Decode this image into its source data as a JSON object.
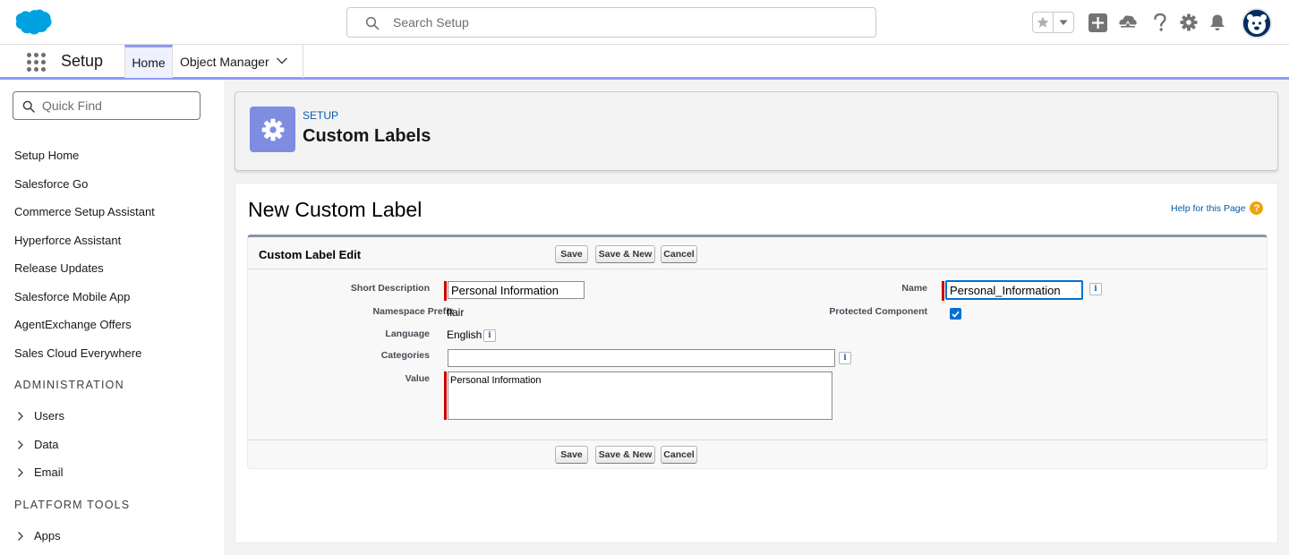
{
  "header": {
    "search_placeholder": "Search Setup"
  },
  "nav": {
    "app_name": "Setup",
    "tabs": [
      {
        "label": "Home"
      },
      {
        "label": "Object Manager"
      }
    ]
  },
  "sidebar": {
    "quick_find_placeholder": "Quick Find",
    "links": [
      "Setup Home",
      "Salesforce Go",
      "Commerce Setup Assistant",
      "Hyperforce Assistant",
      "Release Updates",
      "Salesforce Mobile App",
      "AgentExchange Offers",
      "Sales Cloud Everywhere"
    ],
    "sections": [
      {
        "title": "ADMINISTRATION",
        "items": [
          "Users",
          "Data",
          "Email"
        ]
      },
      {
        "title": "PLATFORM TOOLS",
        "items": [
          "Apps"
        ]
      }
    ]
  },
  "page_header": {
    "eyebrow": "SETUP",
    "title": "Custom Labels"
  },
  "content": {
    "title": "New Custom Label",
    "help_link": "Help for this Page",
    "help_icon_glyph": "?",
    "edit_block": {
      "title": "Custom Label Edit",
      "buttons": {
        "save": "Save",
        "save_new": "Save & New",
        "cancel": "Cancel"
      },
      "fields": {
        "short_description": {
          "label": "Short Description",
          "value": "Personal Information"
        },
        "name": {
          "label": "Name",
          "value": "Personal_Information"
        },
        "namespace_prefix": {
          "label": "Namespace Prefix",
          "value": "flair"
        },
        "protected_component": {
          "label": "Protected Component",
          "checked": true
        },
        "language": {
          "label": "Language",
          "value": "English"
        },
        "categories": {
          "label": "Categories",
          "value": ""
        },
        "value": {
          "label": "Value",
          "value": "Personal Information"
        }
      },
      "info_glyph": "i"
    }
  },
  "colors": {
    "brand_blue": "#00a1e0",
    "accent_purple": "#8b9cf7",
    "header_icon_bg": "#7f8de1",
    "required_red": "#cc0000",
    "link_blue": "#0b5cab"
  }
}
